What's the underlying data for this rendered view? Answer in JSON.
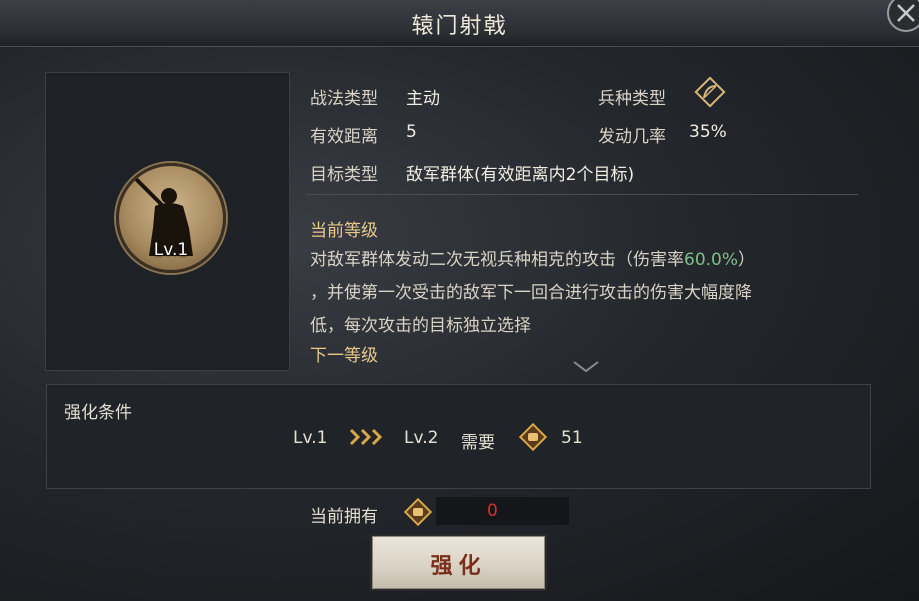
{
  "window": {
    "title": "辕门射戟"
  },
  "portrait": {
    "level": "Lv.1"
  },
  "info": {
    "tactic_type_label": "战法类型",
    "tactic_type_value": "主动",
    "range_label": "有效距离",
    "range_value": "5",
    "target_label": "目标类型",
    "target_value": "敌军群体(有效距离内2个目标)",
    "troop_type_label": "兵种类型",
    "trigger_rate_label": "发动几率",
    "trigger_rate_value": "35%"
  },
  "levels": {
    "current_label": "当前等级",
    "desc_part1": "对敌军群体发动二次无视兵种相克的攻击（伤害率",
    "desc_highlight": "60.0%",
    "desc_part2": "）",
    "desc_line2": "，并使第一次受击的敌军下一回合进行攻击的伤害大幅度降",
    "desc_line3": "低，每次攻击的目标独立选择",
    "next_label": "下一等级"
  },
  "upgrade_condition": {
    "title": "强化条件",
    "from_level": "Lv.1",
    "to_level": "Lv.2",
    "need_label": "需要",
    "need_amount": "51"
  },
  "owned": {
    "label": "当前拥有",
    "amount": "0"
  },
  "upgrade_button": {
    "label": "强化"
  },
  "colors": {
    "highlight": "#7fbf88",
    "warning": "#d8322a",
    "gold": "#e9c98a"
  }
}
